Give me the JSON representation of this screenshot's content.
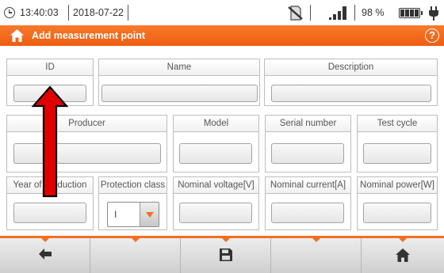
{
  "status_bar": {
    "time": "13:40:03",
    "date": "2018-07-22",
    "battery_percent": "98 %",
    "battery_level": 0.98,
    "icons": [
      "clock-icon",
      "no-memory-card-icon",
      "signal-strength-icon",
      "battery-icon",
      "power-plug-icon"
    ]
  },
  "header": {
    "title": "Add measurement point",
    "icons": [
      "home-icon",
      "help-icon"
    ],
    "help_glyph": "?"
  },
  "colors": {
    "accent": "#f36f20",
    "annotation_arrow": "#e00000",
    "card_border": "#bdbdbd"
  },
  "form": {
    "row1": [
      {
        "label": "ID",
        "value": ""
      },
      {
        "label": "Name",
        "value": ""
      },
      {
        "label": "Description",
        "value": ""
      }
    ],
    "row2": [
      {
        "label": "Producer",
        "value": ""
      },
      {
        "label": "Model",
        "value": ""
      },
      {
        "label": "Serial number",
        "value": ""
      },
      {
        "label": "Test cycle",
        "value": ""
      }
    ],
    "row3": [
      {
        "label": "Year of production",
        "value": ""
      },
      {
        "label": "Protection class",
        "value": "I"
      },
      {
        "label": "Nominal voltage[V]",
        "value": ""
      },
      {
        "label": "Nominal current[A]",
        "value": ""
      },
      {
        "label": "Nominal power[W]",
        "value": ""
      }
    ]
  },
  "toolbar": {
    "buttons": [
      "back-arrow-icon",
      "",
      "save-icon",
      "",
      "home-icon"
    ]
  }
}
